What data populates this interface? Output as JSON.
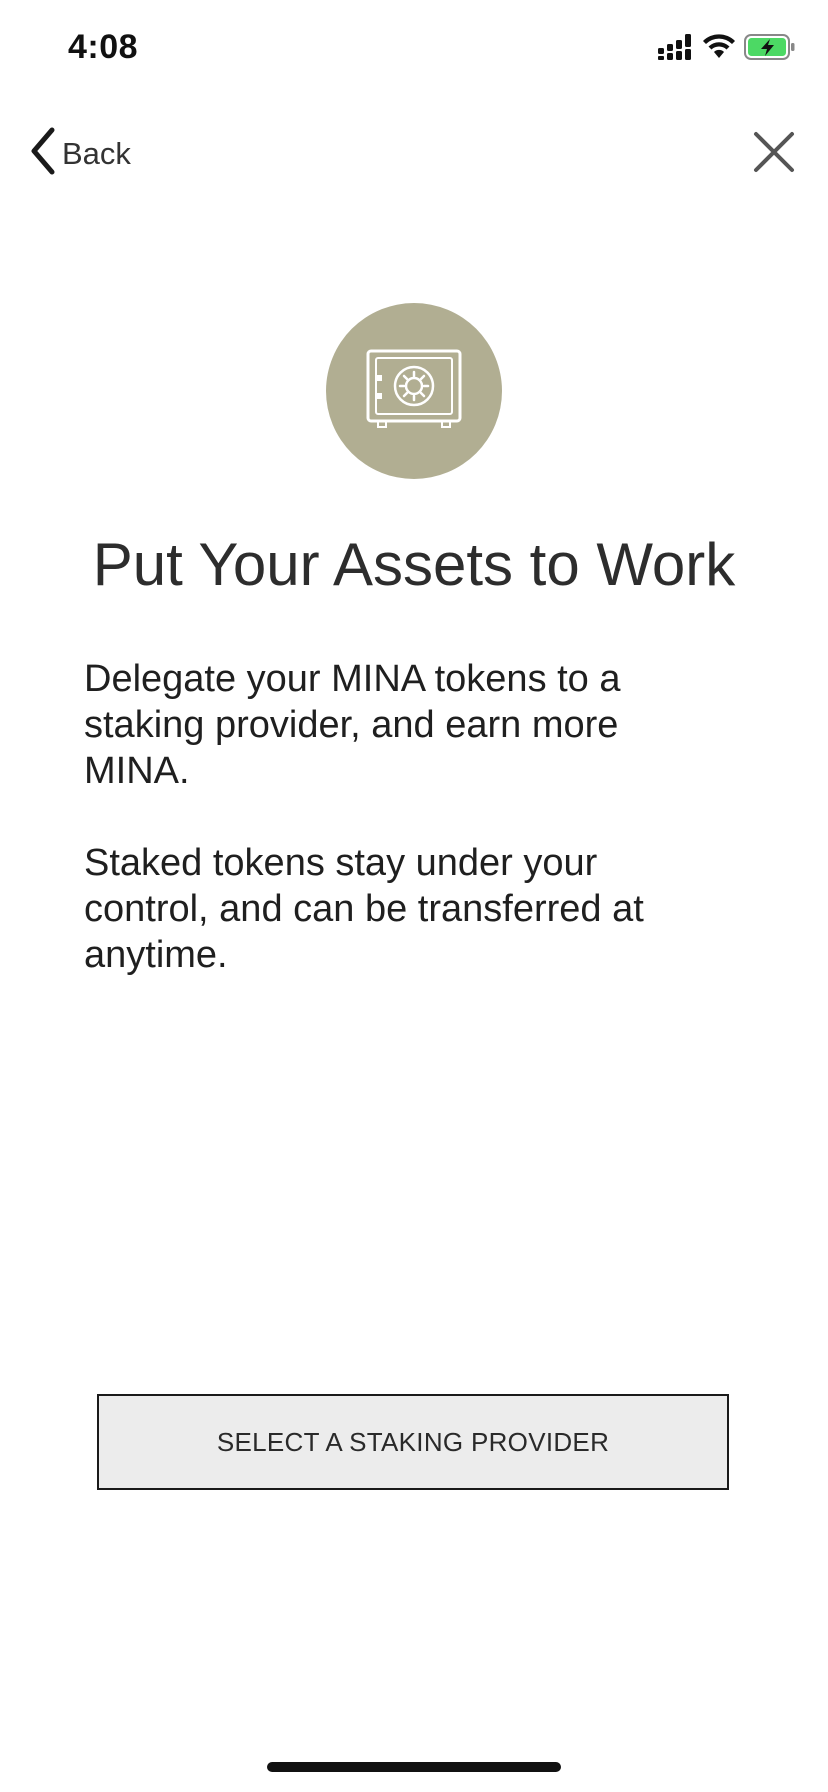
{
  "status_bar": {
    "time": "4:08",
    "icons": [
      "signal-icon",
      "wifi-icon",
      "battery-charging-icon"
    ],
    "battery_color": "#4cd964"
  },
  "nav": {
    "back_label": "Back",
    "back_icon": "chevron-left-icon",
    "close_icon": "close-icon"
  },
  "hero": {
    "icon": "safe-icon",
    "circle_color": "#b1ae92"
  },
  "content": {
    "title": "Put Your Assets to Work",
    "paragraphs": [
      "Delegate your MINA tokens to a staking provider, and earn more MINA.",
      "Staked tokens stay under your control, and can be transferred at anytime."
    ]
  },
  "actions": {
    "primary_label": "SELECT A STAKING PROVIDER"
  }
}
